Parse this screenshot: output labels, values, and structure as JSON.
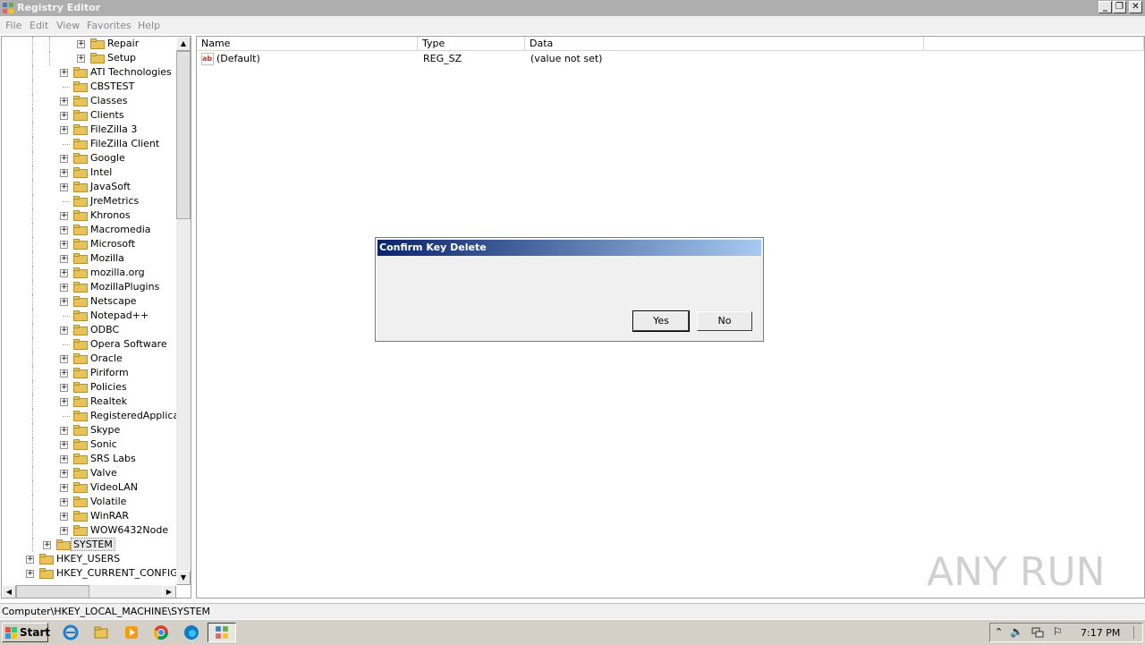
{
  "window": {
    "title": "Registry Editor"
  },
  "menu": [
    "File",
    "Edit",
    "View",
    "Favorites",
    "Help"
  ],
  "tree": [
    {
      "label": "Repair",
      "expander": "+"
    },
    {
      "label": "Setup",
      "expander": "+"
    },
    {
      "label": "ATI Technologies",
      "expander": "+"
    },
    {
      "label": "CBSTEST",
      "expander": ""
    },
    {
      "label": "Classes",
      "expander": "+"
    },
    {
      "label": "Clients",
      "expander": "+"
    },
    {
      "label": "FileZilla 3",
      "expander": "+"
    },
    {
      "label": "FileZilla Client",
      "expander": ""
    },
    {
      "label": "Google",
      "expander": "+"
    },
    {
      "label": "Intel",
      "expander": "+"
    },
    {
      "label": "JavaSoft",
      "expander": "+"
    },
    {
      "label": "JreMetrics",
      "expander": ""
    },
    {
      "label": "Khronos",
      "expander": "+"
    },
    {
      "label": "Macromedia",
      "expander": "+"
    },
    {
      "label": "Microsoft",
      "expander": "+"
    },
    {
      "label": "Mozilla",
      "expander": "+"
    },
    {
      "label": "mozilla.org",
      "expander": "+"
    },
    {
      "label": "MozillaPlugins",
      "expander": "+"
    },
    {
      "label": "Netscape",
      "expander": "+"
    },
    {
      "label": "Notepad++",
      "expander": ""
    },
    {
      "label": "ODBC",
      "expander": "+"
    },
    {
      "label": "Opera Software",
      "expander": ""
    },
    {
      "label": "Oracle",
      "expander": "+"
    },
    {
      "label": "Piriform",
      "expander": "+"
    },
    {
      "label": "Policies",
      "expander": "+"
    },
    {
      "label": "Realtek",
      "expander": "+"
    },
    {
      "label": "RegisteredApplicati",
      "expander": ""
    },
    {
      "label": "Skype",
      "expander": "+"
    },
    {
      "label": "Sonic",
      "expander": "+"
    },
    {
      "label": "SRS Labs",
      "expander": "+"
    },
    {
      "label": "Valve",
      "expander": "+"
    },
    {
      "label": "VideoLAN",
      "expander": "+"
    },
    {
      "label": "Volatile",
      "expander": "+"
    },
    {
      "label": "WinRAR",
      "expander": "+"
    },
    {
      "label": "WOW6432Node",
      "expander": "+"
    },
    {
      "label": "SYSTEM",
      "expander": "+",
      "selected": true
    },
    {
      "label": "HKEY_USERS",
      "expander": "+"
    },
    {
      "label": "HKEY_CURRENT_CONFIG",
      "expander": "+"
    }
  ],
  "list": {
    "columns": [
      "Name",
      "Type",
      "Data"
    ],
    "rows": [
      {
        "name": "(Default)",
        "type": "REG_SZ",
        "data": "(value not set)"
      }
    ]
  },
  "status": "Computer\\HKEY_LOCAL_MACHINE\\SYSTEM",
  "dialog": {
    "title": "Confirm Key Delete",
    "yes": "Yes",
    "no": "No"
  },
  "taskbar": {
    "start": "Start",
    "clock": "7:17 PM"
  },
  "watermark": "ANY RUN",
  "colors": {
    "dialog_title_start": "#0a246a",
    "dialog_title_end": "#a6caf0",
    "folder": "#e8c35a"
  }
}
